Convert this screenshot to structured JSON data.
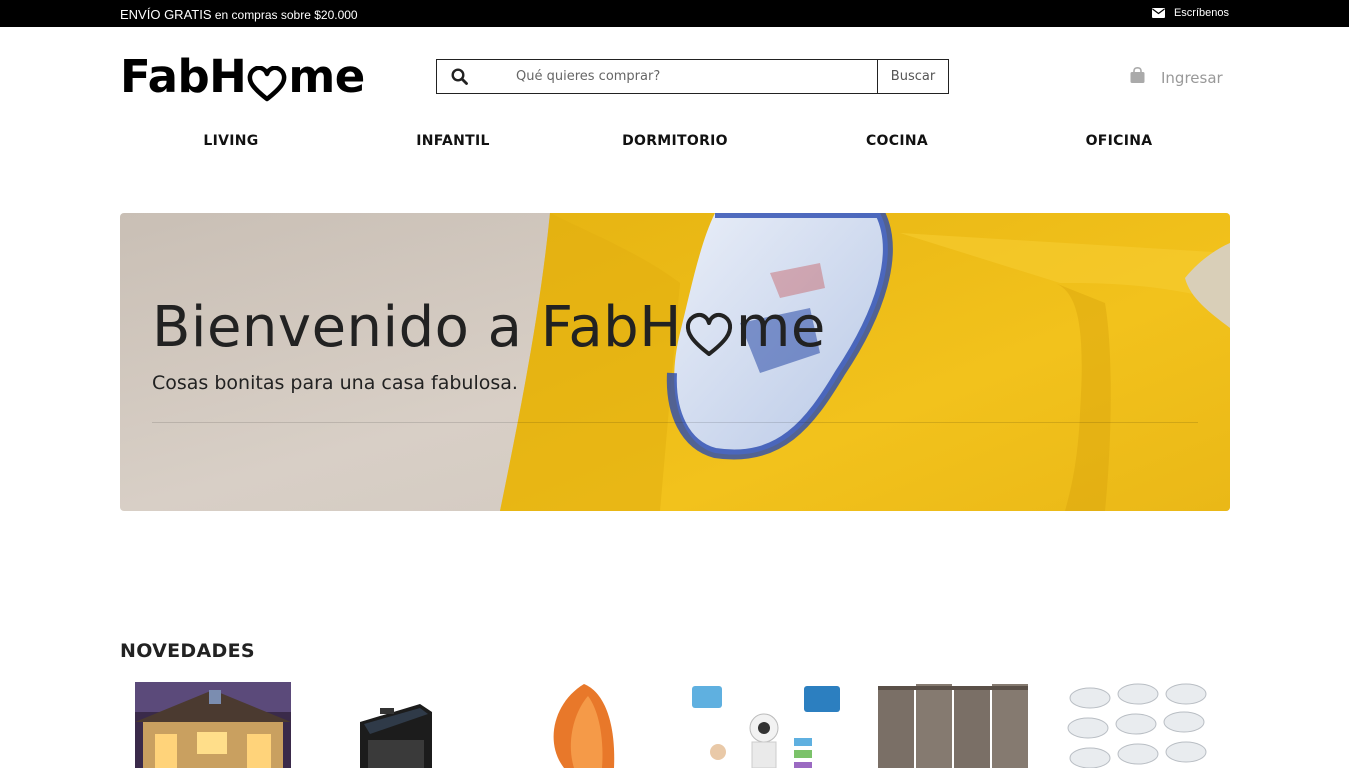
{
  "topbar": {
    "promo_strong": "ENVÍO GRATIS",
    "promo_rest": " en compras sobre $20.000",
    "contact_icon": "envelope-icon",
    "contact_label": "Escríbenos"
  },
  "header": {
    "logo_left": "FabH",
    "logo_right": "me",
    "logo_heart_icon": "heart-icon",
    "search": {
      "placeholder": "Qué quieres comprar?",
      "button_label": "Buscar",
      "icon": "search-icon"
    },
    "login": {
      "icon": "shopping-bag-icon",
      "label": "Ingresar"
    }
  },
  "nav": {
    "items": [
      {
        "label": "LIVING"
      },
      {
        "label": "INFANTIL"
      },
      {
        "label": "DORMITORIO"
      },
      {
        "label": "COCINA"
      },
      {
        "label": "OFICINA"
      }
    ]
  },
  "hero": {
    "title_left": "Bienvenido a FabH",
    "title_right": "me",
    "subtitle": "Cosas bonitas para una casa fabulosa.",
    "colors": {
      "sofa": "#f2c21c",
      "carpet": "#d4cbc2"
    }
  },
  "novedades": {
    "title": "NOVEDADES",
    "products": [
      {
        "icon": "house-lights-image"
      },
      {
        "icon": "solar-lamp-image"
      },
      {
        "icon": "salt-lamp-image"
      },
      {
        "icon": "security-camera-image"
      },
      {
        "icon": "folding-screen-image"
      },
      {
        "icon": "led-panels-image"
      }
    ]
  }
}
